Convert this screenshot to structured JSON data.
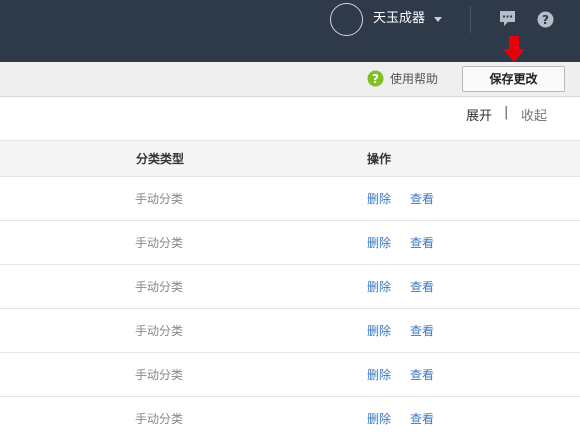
{
  "header": {
    "shop_name": "天玉成器",
    "icons": [
      "avatar",
      "chevron-down-icon",
      "message-icon",
      "help-circle-icon"
    ]
  },
  "toolbar": {
    "help_label": "使用帮助",
    "save_label": "保存更改",
    "annotation": "red-arrow-down-icon"
  },
  "tree_controls": {
    "expand_label": "展开",
    "separator": "|",
    "collapse_label": "收起"
  },
  "table": {
    "columns": [
      "分类类型",
      "操作"
    ],
    "rows": [
      {
        "type": "手动分类",
        "delete": "删除",
        "view": "查看"
      },
      {
        "type": "手动分类",
        "delete": "删除",
        "view": "查看"
      },
      {
        "type": "手动分类",
        "delete": "删除",
        "view": "查看"
      },
      {
        "type": "手动分类",
        "delete": "删除",
        "view": "查看"
      },
      {
        "type": "手动分类",
        "delete": "删除",
        "view": "查看"
      },
      {
        "type": "手动分类",
        "delete": "删除",
        "view": "查看"
      }
    ]
  },
  "colors": {
    "topbar": "#2e3a4a",
    "link": "#3a78c3",
    "help_green": "#7cc11f",
    "annotation_red": "#e8000b"
  }
}
